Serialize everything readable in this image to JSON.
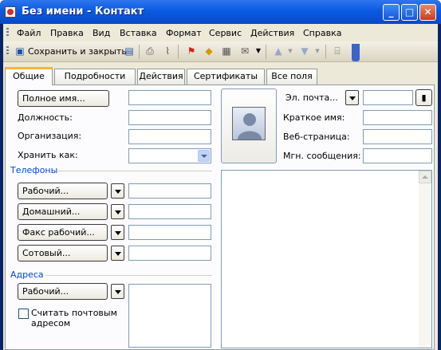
{
  "window": {
    "title": "Без имени - Контакт"
  },
  "menu": [
    "Файл",
    "Правка",
    "Вид",
    "Вставка",
    "Формат",
    "Сервис",
    "Действия",
    "Справка"
  ],
  "toolbar": {
    "save_close_label": "Сохранить и закрыть"
  },
  "tabs": [
    "Общие",
    "Подробности",
    "Действия",
    "Сертификаты",
    "Все поля"
  ],
  "general": {
    "full_name_button": "Полное имя...",
    "position_label": "Должность:",
    "organization_label": "Организация:",
    "file_as_label": "Хранить как:",
    "phones_header": "Телефоны",
    "phone_buttons": [
      "Рабочий...",
      "Домашний...",
      "Факс рабочий...",
      "Сотовый..."
    ],
    "addresses_header": "Адреса",
    "address_button": "Рабочий...",
    "mailing_checkbox": "Считать почтовым адресом",
    "email_button": "Эл. почта...",
    "display_name_label": "Краткое имя:",
    "web_label": "Веб-страница:",
    "im_label": "Мгн. сообщения:"
  },
  "icons": {
    "title": "contact-card-icon",
    "save_close": "save-icon",
    "save": "floppy-icon",
    "print": "printer-icon",
    "attach": "paperclip-icon",
    "flag": "flag-icon",
    "categories": "categories-icon",
    "details": "card-icon",
    "newmsg": "envelope-icon",
    "prev": "up-arrow-icon",
    "next": "down-arrow-icon",
    "address_book": "address-book-icon",
    "check_names": "check-names-icon"
  }
}
